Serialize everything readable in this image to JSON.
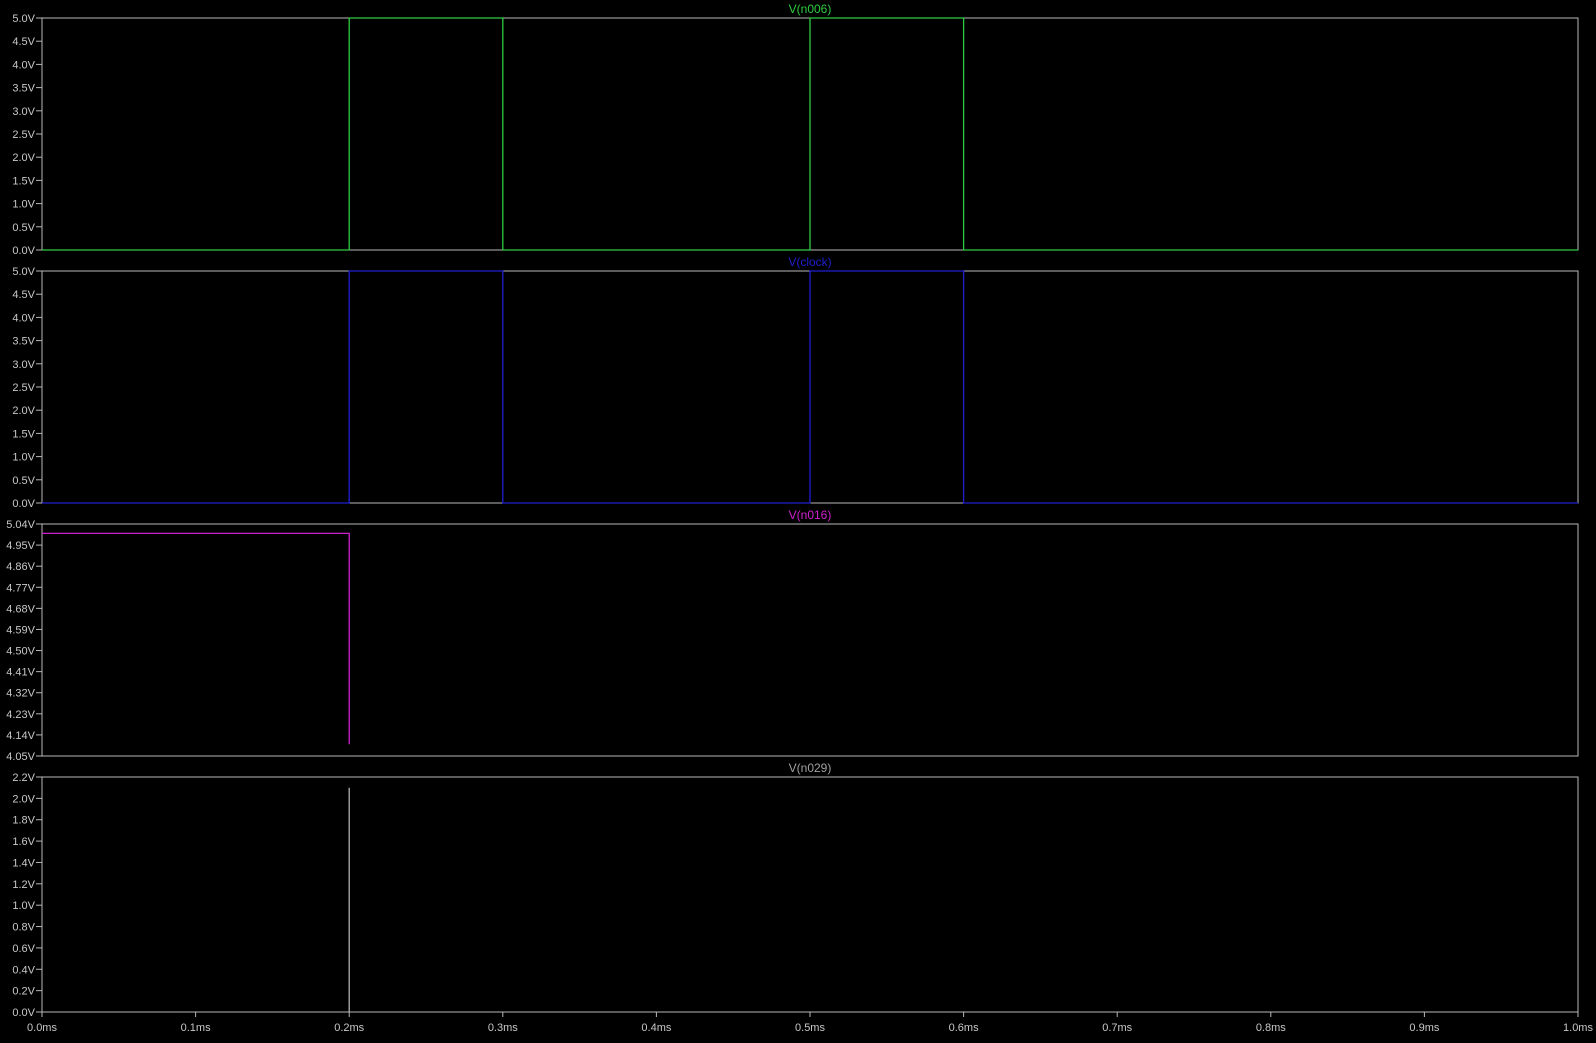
{
  "chart_data": [
    {
      "type": "line",
      "title": "V(n006)",
      "title_color": "#2ecc40",
      "trace_color": "#2ecc40",
      "ylim": [
        0.0,
        5.0
      ],
      "yticks": [
        {
          "value": 0.0,
          "label": "0.0V"
        },
        {
          "value": 0.5,
          "label": "0.5V"
        },
        {
          "value": 1.0,
          "label": "1.0V"
        },
        {
          "value": 1.5,
          "label": "1.5V"
        },
        {
          "value": 2.0,
          "label": "2.0V"
        },
        {
          "value": 2.5,
          "label": "2.5V"
        },
        {
          "value": 3.0,
          "label": "3.0V"
        },
        {
          "value": 3.5,
          "label": "3.5V"
        },
        {
          "value": 4.0,
          "label": "4.0V"
        },
        {
          "value": 4.5,
          "label": "4.5V"
        },
        {
          "value": 5.0,
          "label": "5.0V"
        }
      ],
      "series": [
        {
          "x": [
            0.0,
            0.2,
            0.2,
            0.3,
            0.3,
            0.5,
            0.5,
            0.6,
            0.6,
            1.0
          ],
          "y": [
            0.0,
            0.0,
            5.0,
            5.0,
            0.0,
            0.0,
            5.0,
            5.0,
            0.0,
            0.0
          ]
        }
      ]
    },
    {
      "type": "line",
      "title": "V(clock)",
      "title_color": "#1f1fd0",
      "trace_color": "#1f1fd0",
      "ylim": [
        0.0,
        5.0
      ],
      "yticks": [
        {
          "value": 0.0,
          "label": "0.0V"
        },
        {
          "value": 0.5,
          "label": "0.5V"
        },
        {
          "value": 1.0,
          "label": "1.0V"
        },
        {
          "value": 1.5,
          "label": "1.5V"
        },
        {
          "value": 2.0,
          "label": "2.0V"
        },
        {
          "value": 2.5,
          "label": "2.5V"
        },
        {
          "value": 3.0,
          "label": "3.0V"
        },
        {
          "value": 3.5,
          "label": "3.5V"
        },
        {
          "value": 4.0,
          "label": "4.0V"
        },
        {
          "value": 4.5,
          "label": "4.5V"
        },
        {
          "value": 5.0,
          "label": "5.0V"
        }
      ],
      "series": [
        {
          "x": [
            0.0,
            0.2,
            0.2,
            0.3,
            0.3,
            0.5,
            0.5,
            0.6,
            0.6,
            1.0
          ],
          "y": [
            0.0,
            0.0,
            5.0,
            5.0,
            0.0,
            0.0,
            5.0,
            5.0,
            0.0,
            0.0
          ]
        }
      ]
    },
    {
      "type": "line",
      "title": "V(n016)",
      "title_color": "#d020d0",
      "trace_color": "#d020d0",
      "ylim": [
        4.05,
        5.04
      ],
      "yticks": [
        {
          "value": 4.05,
          "label": "4.05V"
        },
        {
          "value": 4.14,
          "label": "4.14V"
        },
        {
          "value": 4.23,
          "label": "4.23V"
        },
        {
          "value": 4.32,
          "label": "4.32V"
        },
        {
          "value": 4.41,
          "label": "4.41V"
        },
        {
          "value": 4.5,
          "label": "4.50V"
        },
        {
          "value": 4.59,
          "label": "4.59V"
        },
        {
          "value": 4.68,
          "label": "4.68V"
        },
        {
          "value": 4.77,
          "label": "4.77V"
        },
        {
          "value": 4.86,
          "label": "4.86V"
        },
        {
          "value": 4.95,
          "label": "4.95V"
        },
        {
          "value": 5.04,
          "label": "5.04V"
        }
      ],
      "series": [
        {
          "x": [
            0.0,
            0.2,
            0.2
          ],
          "y": [
            5.0,
            5.0,
            4.1
          ]
        }
      ]
    },
    {
      "type": "line",
      "title": "V(n029)",
      "title_color": "#a0a0a0",
      "trace_color": "#b0b0b0",
      "ylim": [
        0.0,
        2.2
      ],
      "yticks": [
        {
          "value": 0.0,
          "label": "0.0V"
        },
        {
          "value": 0.2,
          "label": "0.2V"
        },
        {
          "value": 0.4,
          "label": "0.4V"
        },
        {
          "value": 0.6,
          "label": "0.6V"
        },
        {
          "value": 0.8,
          "label": "0.8V"
        },
        {
          "value": 1.0,
          "label": "1.0V"
        },
        {
          "value": 1.2,
          "label": "1.2V"
        },
        {
          "value": 1.4,
          "label": "1.4V"
        },
        {
          "value": 1.6,
          "label": "1.6V"
        },
        {
          "value": 1.8,
          "label": "1.8V"
        },
        {
          "value": 2.0,
          "label": "2.0V"
        },
        {
          "value": 2.2,
          "label": "2.2V"
        }
      ],
      "series": [
        {
          "x": [
            0.2,
            0.2
          ],
          "y": [
            0.0,
            2.1
          ]
        }
      ]
    }
  ],
  "x_axis": {
    "xlim": [
      0.0,
      1.0
    ],
    "unit": "ms",
    "ticks": [
      {
        "value": 0.0,
        "label": "0.0ms"
      },
      {
        "value": 0.1,
        "label": "0.1ms"
      },
      {
        "value": 0.2,
        "label": "0.2ms"
      },
      {
        "value": 0.3,
        "label": "0.3ms"
      },
      {
        "value": 0.4,
        "label": "0.4ms"
      },
      {
        "value": 0.5,
        "label": "0.5ms"
      },
      {
        "value": 0.6,
        "label": "0.6ms"
      },
      {
        "value": 0.7,
        "label": "0.7ms"
      },
      {
        "value": 0.8,
        "label": "0.8ms"
      },
      {
        "value": 0.9,
        "label": "0.9ms"
      },
      {
        "value": 1.0,
        "label": "1.0ms"
      }
    ]
  },
  "colors": {
    "background": "#000000",
    "frame": "#b8b8b8",
    "tick_text": "#c8c8c8"
  }
}
